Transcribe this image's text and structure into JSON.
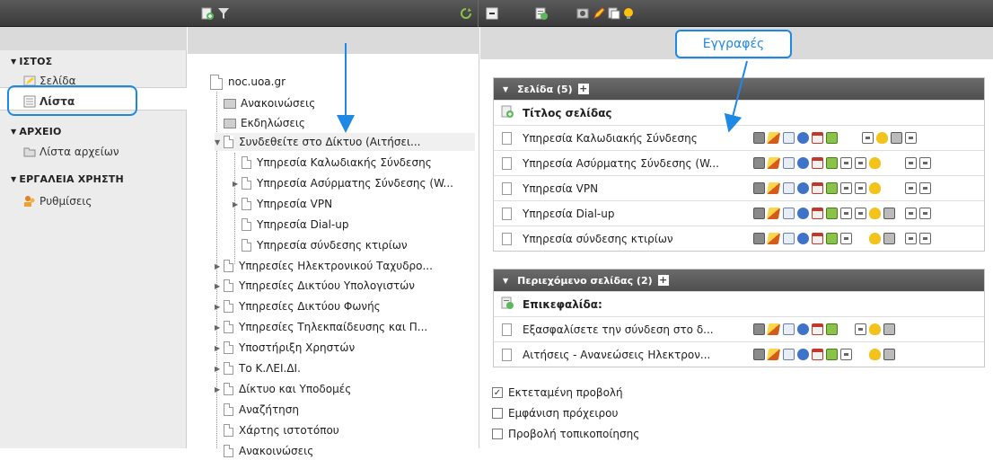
{
  "topbar": {
    "icons": [
      "add-page-icon",
      "filter-icon",
      "refresh-icon",
      "collapse-icon",
      "add-content-icon",
      "preview-icon",
      "edit-icon",
      "copy-icon",
      "bulb-icon"
    ]
  },
  "sidebar": {
    "sections": [
      {
        "title": "ΙΣΤΟΣ",
        "items": [
          {
            "label": "Σελίδα",
            "icon": "page-edit-icon"
          },
          {
            "label": "Λίστα",
            "icon": "list-icon",
            "selected": true
          }
        ]
      },
      {
        "title": "ΑΡΧΕΙΟ",
        "items": [
          {
            "label": "Λίστα αρχείων",
            "icon": "folder-icon"
          }
        ]
      },
      {
        "title": "ΕΡΓΑΛΕΙΑ ΧΡΗΣΤΗ",
        "items": [
          {
            "label": "Ρυθμίσεις",
            "icon": "users-icon"
          }
        ]
      }
    ]
  },
  "tree": {
    "root": "noc.uoa.gr",
    "nodes": [
      "Ανακοινώσεις",
      "Εκδηλώσεις",
      "Συνδεθείτε στο Δίκτυο (Αιτήσει...",
      "Υπηρεσία Καλωδιακής Σύνδεσης",
      "Υπηρεσία Ασύρματης Σύνδεσης (W...",
      "Υπηρεσία VPN",
      "Υπηρεσία Dial-up",
      "Υπηρεσία σύνδεσης κτιρίων",
      "Υπηρεσίες Ηλεκτρονικού Ταχυδρο...",
      "Υπηρεσίες Δικτύου Υπολογιστών",
      "Υπηρεσίες Δικτύου Φωνής",
      "Υπηρεσίες Τηλεκπαίδευσης και Π...",
      "Υποστήριξη Χρηστών",
      "Το Κ.ΛΕΙ.ΔΙ.",
      "Δίκτυο και Υποδομές",
      "Αναζήτηση",
      "Χάρτης ιστοτόπου",
      "Ανακοινώσεις"
    ]
  },
  "annotation": {
    "label": "Εγγραφές"
  },
  "pages_panel": {
    "header": "Σελίδα (5)",
    "column_title": "Τίτλος σελίδας",
    "rows": [
      "Υπηρεσία Καλωδιακής Σύνδεσης",
      "Υπηρεσία Ασύρματης Σύνδεσης (W...",
      "Υπηρεσία VPN",
      "Υπηρεσία Dial-up",
      "Υπηρεσία σύνδεσης κτιρίων"
    ]
  },
  "content_panel": {
    "header": "Περιεχόμενο σελίδας (2)",
    "column_title": "Επικεφαλίδα:",
    "rows": [
      "Εξασφαλίσετε την σύνδεση στο δ...",
      "Αιτήσεις - Ανανεώσεις Ηλεκτρον..."
    ]
  },
  "options": [
    {
      "label": "Εκτεταμένη προβολή",
      "checked": true
    },
    {
      "label": "Εμφάνιση πρόχειρου",
      "checked": false
    },
    {
      "label": "Προβολή τοπικοποίησης",
      "checked": false
    }
  ],
  "colors": {
    "accent_blue": "#1e88e5",
    "toolbar_dark": "#4a4a4a",
    "panel_head": "#5c5c5c"
  }
}
